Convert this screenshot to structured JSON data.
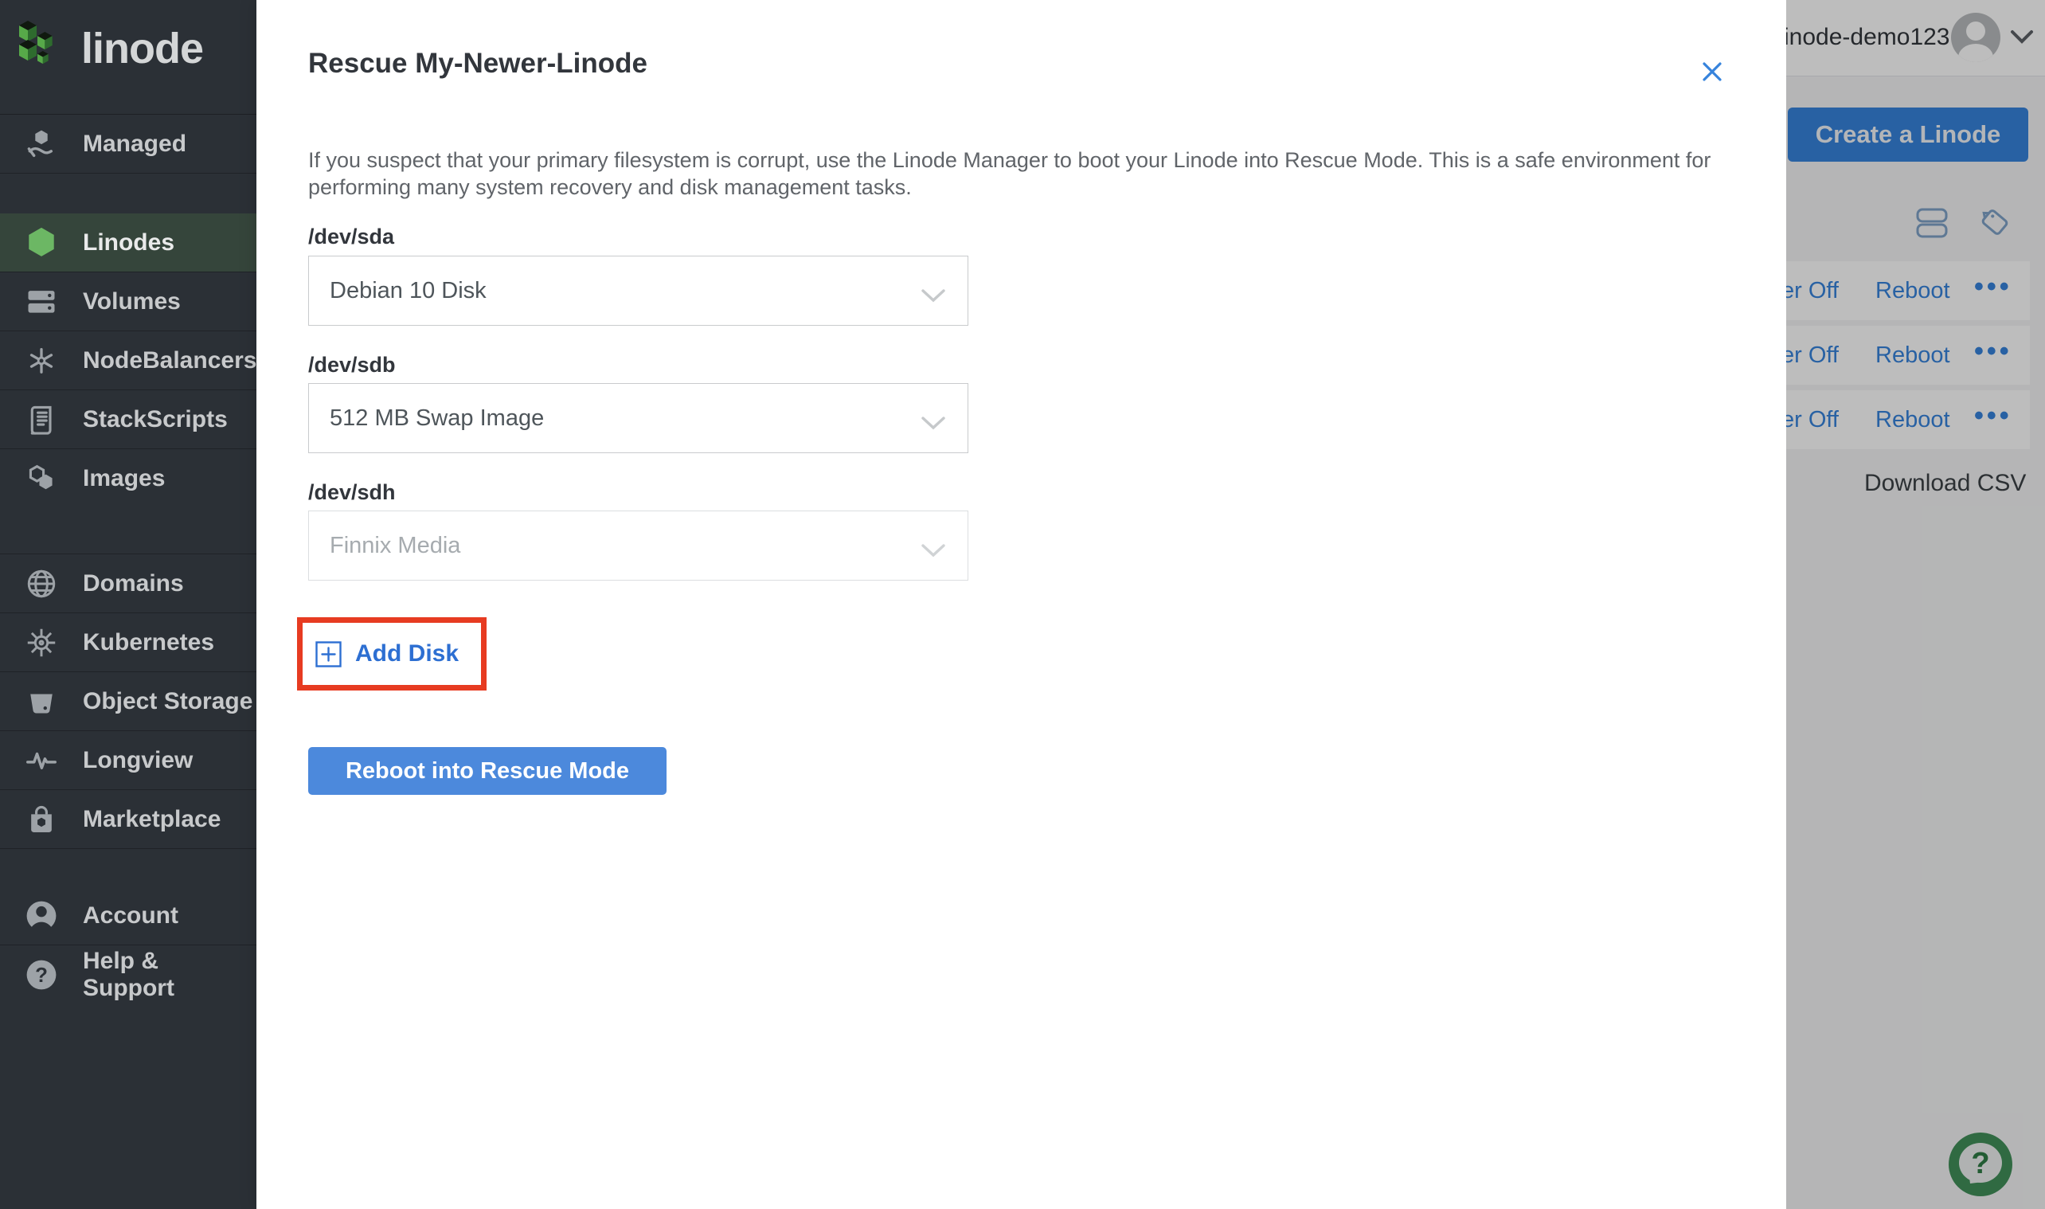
{
  "sidebar": {
    "logo_text": "linode",
    "items": [
      {
        "label": "Managed"
      },
      {
        "label": "Linodes",
        "active": true
      },
      {
        "label": "Volumes"
      },
      {
        "label": "NodeBalancers"
      },
      {
        "label": "StackScripts"
      },
      {
        "label": "Images"
      },
      {
        "label": "Domains"
      },
      {
        "label": "Kubernetes"
      },
      {
        "label": "Object Storage"
      },
      {
        "label": "Longview"
      },
      {
        "label": "Marketplace"
      },
      {
        "label": "Account"
      },
      {
        "label": "Help & Support"
      }
    ]
  },
  "modal": {
    "title": "Rescue My-Newer-Linode",
    "description": "If you suspect that your primary filesystem is corrupt, use the Linode Manager to boot your Linode into Rescue Mode. This is a safe environment for performing many system recovery and disk management tasks.",
    "fields": [
      {
        "label": "/dev/sda",
        "value": "Debian 10 Disk",
        "disabled": false
      },
      {
        "label": "/dev/sdb",
        "value": "512 MB Swap Image",
        "disabled": false
      },
      {
        "label": "/dev/sdh",
        "value": "Finnix Media",
        "disabled": true
      }
    ],
    "add_disk_label": "Add Disk",
    "submit_label": "Reboot into Rescue Mode"
  },
  "background": {
    "account_name": "inode-demo123",
    "create_button_label": "Create a Linode",
    "rows": [
      {
        "power": "er Off",
        "reboot": "Reboot",
        "more": "•••"
      },
      {
        "power": "er Off",
        "reboot": "Reboot",
        "more": "•••"
      },
      {
        "power": "er Off",
        "reboot": "Reboot",
        "more": "•••"
      }
    ],
    "download_csv_label": "Download CSV",
    "help_glyph": "?"
  },
  "colors": {
    "accent_blue": "#3683dc",
    "button_blue": "#4c89dc",
    "brand_green": "#57a949",
    "active_nav_green": "#35453b",
    "annotation_red": "#e73b21",
    "sidebar_bg": "#2b3036",
    "fab_green": "#41905a"
  }
}
